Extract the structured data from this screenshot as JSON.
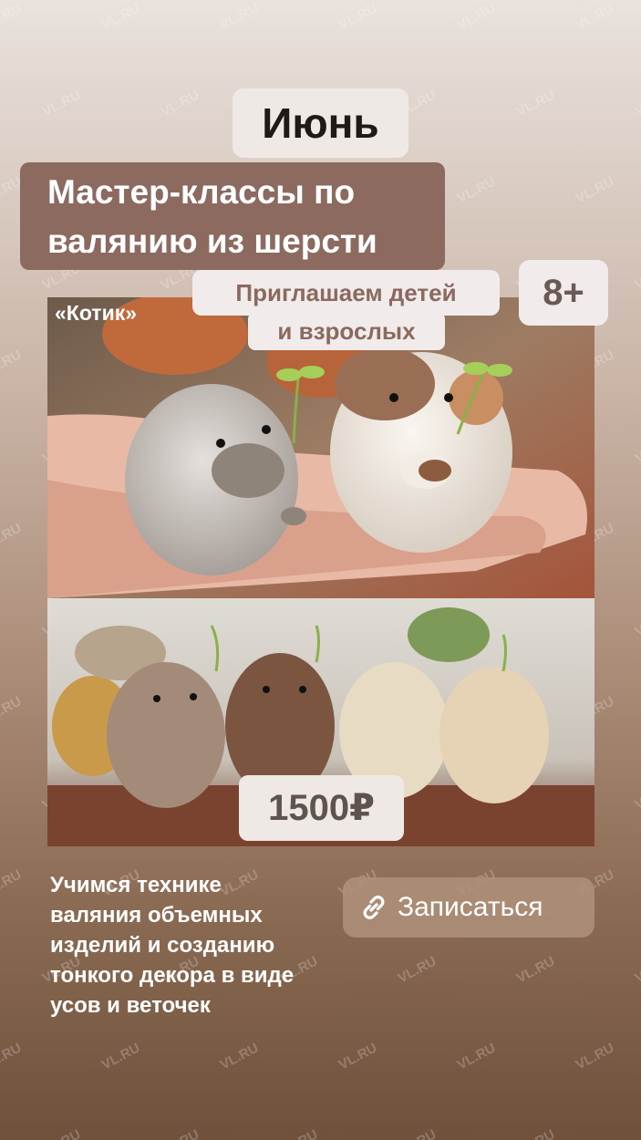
{
  "story": {
    "month": "Июнь",
    "title_line1": "Мастер-классы по",
    "title_line2": "валянию из шерсти",
    "invite_line1": "Приглашаем детей",
    "invite_line2": "и взрослых",
    "age_badge": "8+",
    "photo_caption": "«Котик»",
    "price": "1500₽",
    "description": [
      "Учимся технике",
      "валяния объемных",
      "изделий и созданию",
      "тонкого декора в виде",
      "усов и веточек"
    ],
    "signup_label": "Записаться",
    "signup_icon": "link-icon",
    "watermark": "VL.RU"
  }
}
